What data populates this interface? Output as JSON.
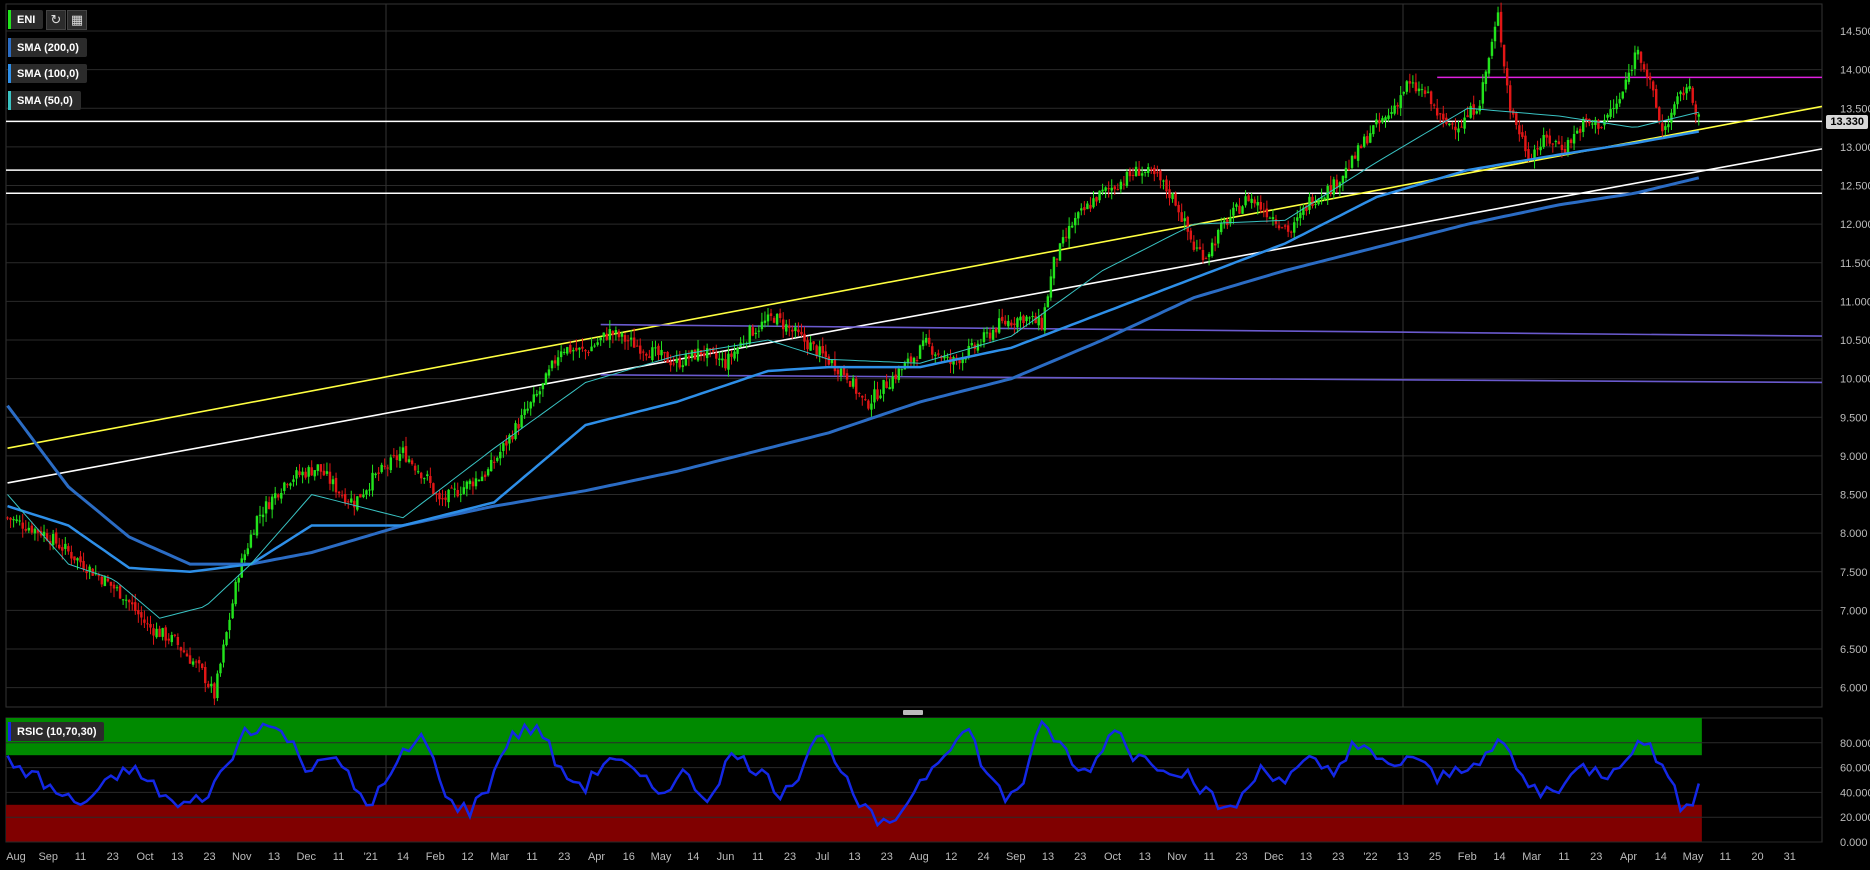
{
  "symbol": "ENI",
  "indicators": [
    {
      "label": "SMA (200,0)",
      "color": "#2b6cc4"
    },
    {
      "label": "SMA (100,0)",
      "color": "#2e8fe8"
    },
    {
      "label": "SMA (50,0)",
      "color": "#39c3c3"
    }
  ],
  "rsi_label": "RSIC (10,70,30)",
  "last_price": "13.330",
  "toolbar": {
    "refresh_icon": "refresh-icon",
    "calendar_icon": "calendar-icon"
  },
  "colors": {
    "up": "#22e31c",
    "down": "#e11616",
    "sma200": "#2b6cc4",
    "sma100": "#2e8fe8",
    "sma50": "#39c3c3",
    "rsi": "#1428e6",
    "overbought": "#008a00",
    "oversold": "#800000"
  },
  "chart_data": [
    {
      "type": "candlestick",
      "yticks": [
        "14.500",
        "14.000",
        "13.500",
        "13.000",
        "12.500",
        "12.000",
        "11.500",
        "11.000",
        "10.500",
        "10.000",
        "9.500",
        "9.000",
        "8.500",
        "8.000",
        "7.500",
        "7.000",
        "6.500",
        "6.000"
      ],
      "ylim": [
        5.75,
        14.85
      ],
      "xticks": [
        "Aug",
        "Sep",
        "11",
        "23",
        "Oct",
        "13",
        "23",
        "Nov",
        "13",
        "Dec",
        "11",
        "'21",
        "14",
        "Feb",
        "12",
        "Mar",
        "11",
        "23",
        "Apr",
        "16",
        "May",
        "14",
        "Jun",
        "11",
        "23",
        "Jul",
        "13",
        "23",
        "Aug",
        "12",
        "24",
        "Sep",
        "13",
        "23",
        "Oct",
        "13",
        "Nov",
        "11",
        "23",
        "Dec",
        "13",
        "23",
        "'22",
        "13",
        "25",
        "Feb",
        "14",
        "Mar",
        "11",
        "23",
        "Apr",
        "14",
        "May",
        "11",
        "20",
        "31"
      ],
      "close_path": [
        [
          0,
          8.2
        ],
        [
          12,
          8.0
        ],
        [
          25,
          7.6
        ],
        [
          38,
          7.2
        ],
        [
          46,
          6.8
        ],
        [
          55,
          6.6
        ],
        [
          64,
          6.2
        ],
        [
          68,
          5.9
        ],
        [
          72,
          6.7
        ],
        [
          76,
          7.5
        ],
        [
          82,
          8.2
        ],
        [
          92,
          8.7
        ],
        [
          102,
          8.85
        ],
        [
          110,
          8.5
        ],
        [
          114,
          8.4
        ],
        [
          120,
          8.7
        ],
        [
          126,
          8.9
        ],
        [
          130,
          9.05
        ],
        [
          138,
          8.7
        ],
        [
          142,
          8.4
        ],
        [
          150,
          8.6
        ],
        [
          158,
          8.8
        ],
        [
          166,
          9.3
        ],
        [
          176,
          9.9
        ],
        [
          182,
          10.4
        ],
        [
          190,
          10.35
        ],
        [
          198,
          10.6
        ],
        [
          206,
          10.45
        ],
        [
          214,
          10.3
        ],
        [
          220,
          10.2
        ],
        [
          228,
          10.35
        ],
        [
          236,
          10.2
        ],
        [
          244,
          10.6
        ],
        [
          252,
          10.8
        ],
        [
          260,
          10.55
        ],
        [
          268,
          10.3
        ],
        [
          276,
          10.05
        ],
        [
          282,
          9.65
        ],
        [
          288,
          9.9
        ],
        [
          296,
          10.2
        ],
        [
          302,
          10.45
        ],
        [
          310,
          10.2
        ],
        [
          318,
          10.4
        ],
        [
          326,
          10.7
        ],
        [
          334,
          10.8
        ],
        [
          340,
          10.7
        ],
        [
          344,
          11.5
        ],
        [
          350,
          12.0
        ],
        [
          358,
          12.35
        ],
        [
          366,
          12.55
        ],
        [
          372,
          12.7
        ],
        [
          378,
          12.6
        ],
        [
          384,
          12.3
        ],
        [
          390,
          11.7
        ],
        [
          394,
          11.6
        ],
        [
          400,
          12.0
        ],
        [
          408,
          12.35
        ],
        [
          416,
          12.1
        ],
        [
          422,
          11.9
        ],
        [
          428,
          12.3
        ],
        [
          436,
          12.5
        ],
        [
          442,
          12.8
        ],
        [
          448,
          13.2
        ],
        [
          454,
          13.4
        ],
        [
          460,
          13.8
        ],
        [
          466,
          13.7
        ],
        [
          472,
          13.3
        ],
        [
          478,
          13.3
        ],
        [
          484,
          13.6
        ],
        [
          490,
          14.7
        ],
        [
          494,
          13.5
        ],
        [
          500,
          12.9
        ],
        [
          506,
          13.1
        ],
        [
          512,
          13.0
        ],
        [
          518,
          13.3
        ],
        [
          524,
          13.3
        ],
        [
          530,
          13.6
        ],
        [
          536,
          14.3
        ],
        [
          540,
          13.8
        ],
        [
          544,
          13.2
        ],
        [
          548,
          13.5
        ],
        [
          552,
          13.8
        ],
        [
          556,
          13.4
        ]
      ],
      "sma200_path": [
        [
          0,
          9.65
        ],
        [
          20,
          8.6
        ],
        [
          40,
          7.95
        ],
        [
          60,
          7.6
        ],
        [
          80,
          7.6
        ],
        [
          100,
          7.75
        ],
        [
          130,
          8.1
        ],
        [
          160,
          8.35
        ],
        [
          190,
          8.55
        ],
        [
          220,
          8.8
        ],
        [
          250,
          9.1
        ],
        [
          270,
          9.3
        ],
        [
          300,
          9.7
        ],
        [
          330,
          10.0
        ],
        [
          360,
          10.5
        ],
        [
          390,
          11.05
        ],
        [
          420,
          11.4
        ],
        [
          450,
          11.7
        ],
        [
          480,
          12.0
        ],
        [
          510,
          12.25
        ],
        [
          535,
          12.4
        ],
        [
          556,
          12.6
        ]
      ],
      "sma100_path": [
        [
          0,
          8.35
        ],
        [
          20,
          8.1
        ],
        [
          40,
          7.55
        ],
        [
          60,
          7.5
        ],
        [
          80,
          7.6
        ],
        [
          100,
          8.1
        ],
        [
          130,
          8.1
        ],
        [
          160,
          8.4
        ],
        [
          190,
          9.4
        ],
        [
          220,
          9.7
        ],
        [
          250,
          10.1
        ],
        [
          270,
          10.15
        ],
        [
          300,
          10.15
        ],
        [
          330,
          10.4
        ],
        [
          360,
          10.85
        ],
        [
          390,
          11.3
        ],
        [
          420,
          11.75
        ],
        [
          450,
          12.35
        ],
        [
          480,
          12.7
        ],
        [
          510,
          12.9
        ],
        [
          535,
          13.05
        ],
        [
          556,
          13.2
        ]
      ],
      "sma50_path": [
        [
          0,
          8.5
        ],
        [
          20,
          7.6
        ],
        [
          35,
          7.4
        ],
        [
          50,
          6.9
        ],
        [
          65,
          7.05
        ],
        [
          80,
          7.6
        ],
        [
          100,
          8.5
        ],
        [
          130,
          8.2
        ],
        [
          160,
          9.1
        ],
        [
          190,
          9.95
        ],
        [
          220,
          10.3
        ],
        [
          250,
          10.5
        ],
        [
          270,
          10.25
        ],
        [
          300,
          10.2
        ],
        [
          330,
          10.55
        ],
        [
          360,
          11.4
        ],
        [
          390,
          12.0
        ],
        [
          420,
          12.05
        ],
        [
          450,
          12.8
        ],
        [
          480,
          13.5
        ],
        [
          510,
          13.4
        ],
        [
          535,
          13.25
        ],
        [
          556,
          13.45
        ]
      ],
      "horizontal_lines": [
        {
          "value": 13.33,
          "color": "#ffffff"
        },
        {
          "value": 12.7,
          "color": "#ffffff"
        },
        {
          "value": 12.4,
          "color": "#ffffff"
        },
        {
          "value": 13.9,
          "color": "#e020e0",
          "from_index": 470
        }
      ],
      "trend_lines": [
        {
          "from": [
            0,
            9.1
          ],
          "to": [
            600,
            13.55
          ],
          "color": "#ffff40"
        },
        {
          "from": [
            0,
            8.65
          ],
          "to": [
            600,
            13.0
          ],
          "color": "#ffffff"
        },
        {
          "from": [
            195,
            10.7
          ],
          "to": [
            600,
            10.55
          ],
          "color": "#6a5acd"
        },
        {
          "from": [
            195,
            10.05
          ],
          "to": [
            600,
            9.95
          ],
          "color": "#6a5acd"
        }
      ],
      "n_bars": 557
    },
    {
      "type": "line",
      "name": "RSIC (10,70,30)",
      "yticks": [
        "80.000",
        "60.000",
        "40.000",
        "20.000",
        "0.000"
      ],
      "ylim": [
        0,
        100
      ],
      "overbought": 70,
      "oversold": 30,
      "rsi_path": [
        [
          0,
          65
        ],
        [
          8,
          55
        ],
        [
          16,
          40
        ],
        [
          24,
          30
        ],
        [
          32,
          45
        ],
        [
          40,
          60
        ],
        [
          48,
          45
        ],
        [
          56,
          28
        ],
        [
          64,
          35
        ],
        [
          72,
          60
        ],
        [
          78,
          90
        ],
        [
          84,
          95
        ],
        [
          92,
          85
        ],
        [
          98,
          60
        ],
        [
          104,
          70
        ],
        [
          110,
          60
        ],
        [
          118,
          30
        ],
        [
          124,
          45
        ],
        [
          130,
          70
        ],
        [
          136,
          85
        ],
        [
          140,
          65
        ],
        [
          146,
          30
        ],
        [
          152,
          25
        ],
        [
          158,
          45
        ],
        [
          164,
          80
        ],
        [
          170,
          92
        ],
        [
          176,
          88
        ],
        [
          182,
          55
        ],
        [
          190,
          45
        ],
        [
          198,
          70
        ],
        [
          206,
          55
        ],
        [
          214,
          40
        ],
        [
          222,
          55
        ],
        [
          230,
          35
        ],
        [
          238,
          70
        ],
        [
          246,
          60
        ],
        [
          254,
          40
        ],
        [
          260,
          55
        ],
        [
          266,
          88
        ],
        [
          272,
          70
        ],
        [
          278,
          35
        ],
        [
          284,
          20
        ],
        [
          290,
          10
        ],
        [
          296,
          35
        ],
        [
          302,
          55
        ],
        [
          310,
          80
        ],
        [
          316,
          90
        ],
        [
          322,
          55
        ],
        [
          328,
          35
        ],
        [
          334,
          50
        ],
        [
          340,
          95
        ],
        [
          346,
          80
        ],
        [
          352,
          55
        ],
        [
          358,
          65
        ],
        [
          364,
          95
        ],
        [
          370,
          70
        ],
        [
          376,
          65
        ],
        [
          382,
          60
        ],
        [
          388,
          55
        ],
        [
          394,
          40
        ],
        [
          400,
          25
        ],
        [
          406,
          35
        ],
        [
          412,
          60
        ],
        [
          420,
          50
        ],
        [
          428,
          65
        ],
        [
          436,
          55
        ],
        [
          442,
          80
        ],
        [
          448,
          70
        ],
        [
          454,
          60
        ],
        [
          462,
          70
        ],
        [
          470,
          50
        ],
        [
          478,
          60
        ],
        [
          486,
          70
        ],
        [
          492,
          80
        ],
        [
          498,
          50
        ],
        [
          504,
          40
        ],
        [
          510,
          45
        ],
        [
          518,
          60
        ],
        [
          526,
          55
        ],
        [
          534,
          75
        ],
        [
          540,
          80
        ],
        [
          546,
          50
        ],
        [
          550,
          30
        ],
        [
          554,
          35
        ],
        [
          557,
          60
        ]
      ]
    }
  ]
}
